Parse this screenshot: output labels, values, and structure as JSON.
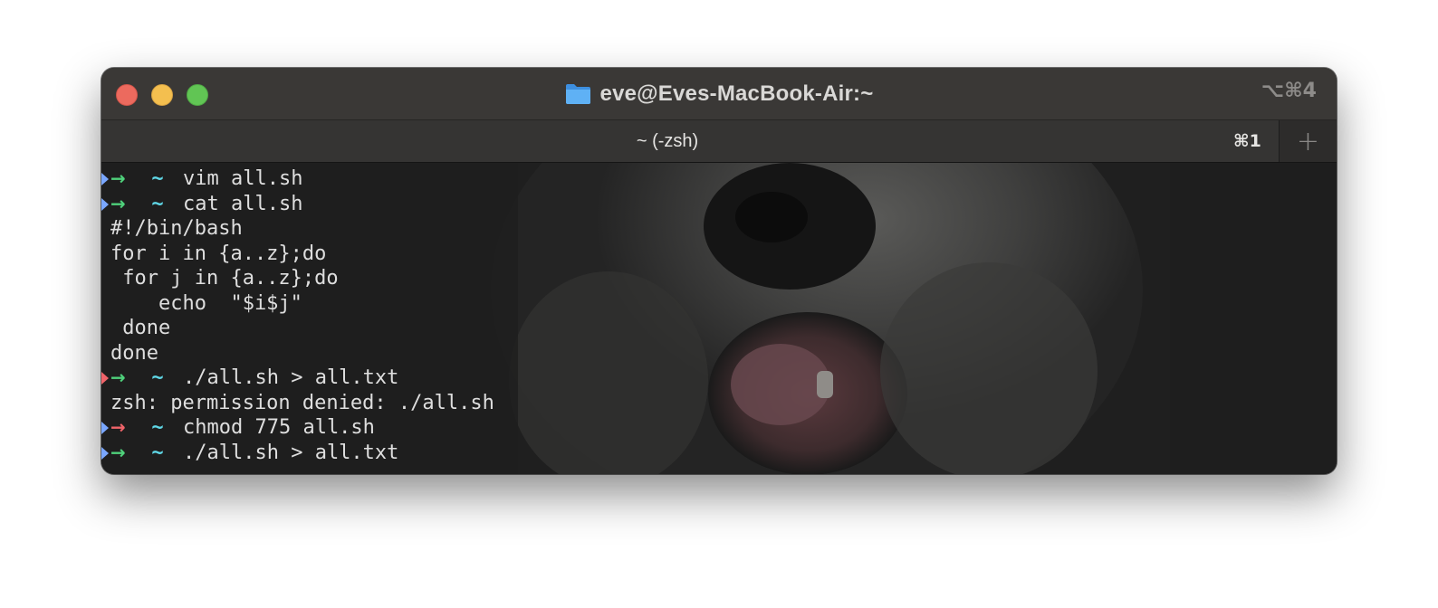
{
  "window": {
    "title": "eve@Eves-MacBook-Air:~",
    "shortcut": "⌥⌘4"
  },
  "tabs": [
    {
      "label": "~ (-zsh)",
      "shortcut": "⌘1"
    }
  ],
  "new_tab_label": "+",
  "icons": {
    "folder": "folder-icon",
    "close": "close-icon",
    "minimize": "minimize-icon",
    "maximize": "maximize-icon",
    "new_tab": "plus-icon"
  },
  "colors": {
    "prompt_ok": "#4fd17b",
    "prompt_err": "#f0646a",
    "tilde": "#5fd7e6",
    "marker_ok": "#7aa7ff",
    "marker_err": "#f0646a",
    "text": "#dedede"
  },
  "terminal": {
    "prompt_arrow": "→",
    "prompt_dir": "~",
    "lines": [
      {
        "kind": "prompt",
        "marker": "ok",
        "arrow": "ok",
        "text": "vim all.sh"
      },
      {
        "kind": "prompt",
        "marker": "ok",
        "arrow": "ok",
        "text": "cat all.sh"
      },
      {
        "kind": "output",
        "text": "#!/bin/bash"
      },
      {
        "kind": "output",
        "text": "for i in {a..z};do"
      },
      {
        "kind": "output",
        "text": " for j in {a..z};do"
      },
      {
        "kind": "output",
        "text": "    echo  \"$i$j\""
      },
      {
        "kind": "output",
        "text": " done"
      },
      {
        "kind": "output",
        "text": "done"
      },
      {
        "kind": "prompt",
        "marker": "err",
        "arrow": "ok",
        "text": "./all.sh > all.txt"
      },
      {
        "kind": "output",
        "text": "zsh: permission denied: ./all.sh"
      },
      {
        "kind": "prompt",
        "marker": "ok",
        "arrow": "err",
        "text": "chmod 775 all.sh"
      },
      {
        "kind": "prompt",
        "marker": "ok",
        "arrow": "ok",
        "text": "./all.sh > all.txt"
      }
    ]
  }
}
